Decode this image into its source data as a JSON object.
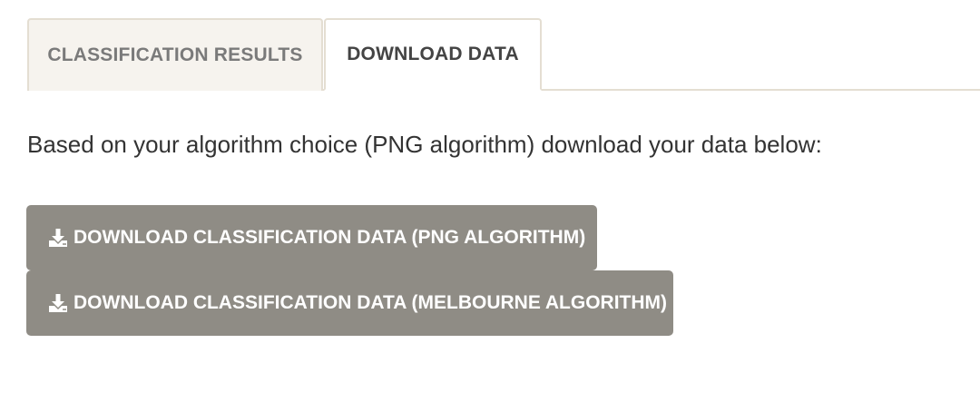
{
  "tabs": [
    {
      "label": "CLASSIFICATION RESULTS",
      "active": false
    },
    {
      "label": "DOWNLOAD DATA",
      "active": true
    }
  ],
  "intro_text": "Based on your algorithm choice (PNG algorithm) download your data below:",
  "buttons": {
    "png_label": "DOWNLOAD CLASSIFICATION DATA (PNG ALGORITHM)",
    "melbourne_label": "DOWNLOAD CLASSIFICATION DATA (MELBOURNE ALGORITHM)",
    "icon": "download-icon"
  },
  "colors": {
    "button_bg": "#8f8c85",
    "tab_inactive_bg": "#f6f3ee",
    "border": "#e4ded2"
  }
}
